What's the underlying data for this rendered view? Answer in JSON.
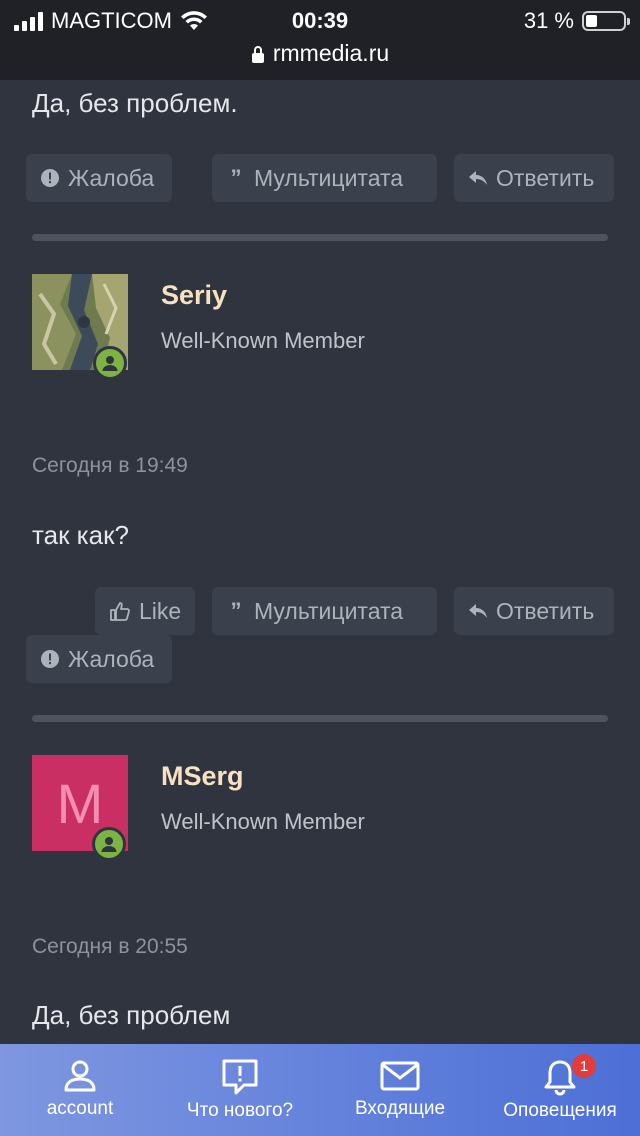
{
  "status_bar": {
    "carrier": "MAGTICOM",
    "time": "00:39",
    "battery_percent": "31 %",
    "battery_level": 0.31,
    "url": "rmmedia.ru"
  },
  "post_prev": {
    "text": "Да, без проблем.",
    "actions": {
      "report": "Жалоба",
      "multiquote": "Мультицитата",
      "reply": "Ответить"
    }
  },
  "post_seriy": {
    "username": "Seriy",
    "user_title": "Well-Known Member",
    "date": "Сегодня в 19:49",
    "text": "так как?",
    "actions": {
      "like": "Like",
      "multiquote": "Мультицитата",
      "reply": "Ответить",
      "report": "Жалоба"
    }
  },
  "post_mserg": {
    "username": "MSerg",
    "avatar_letter": "M",
    "avatar_color": "#c92f63",
    "user_title": "Well-Known Member",
    "date": "Сегодня в 20:55",
    "text": "Да, без проблем"
  },
  "tab_bar": {
    "tabs": [
      {
        "label": "account",
        "icon": "user-icon"
      },
      {
        "label": "Что нового?",
        "icon": "alert-bubble-icon"
      },
      {
        "label": "Входящие",
        "icon": "envelope-icon"
      },
      {
        "label": "Оповещения",
        "icon": "bell-icon",
        "badge": "1"
      }
    ]
  },
  "colors": {
    "background": "#2f343f",
    "username": "#f6e1c2",
    "online": "#7cb342",
    "tab_bar": "#6583dc"
  }
}
